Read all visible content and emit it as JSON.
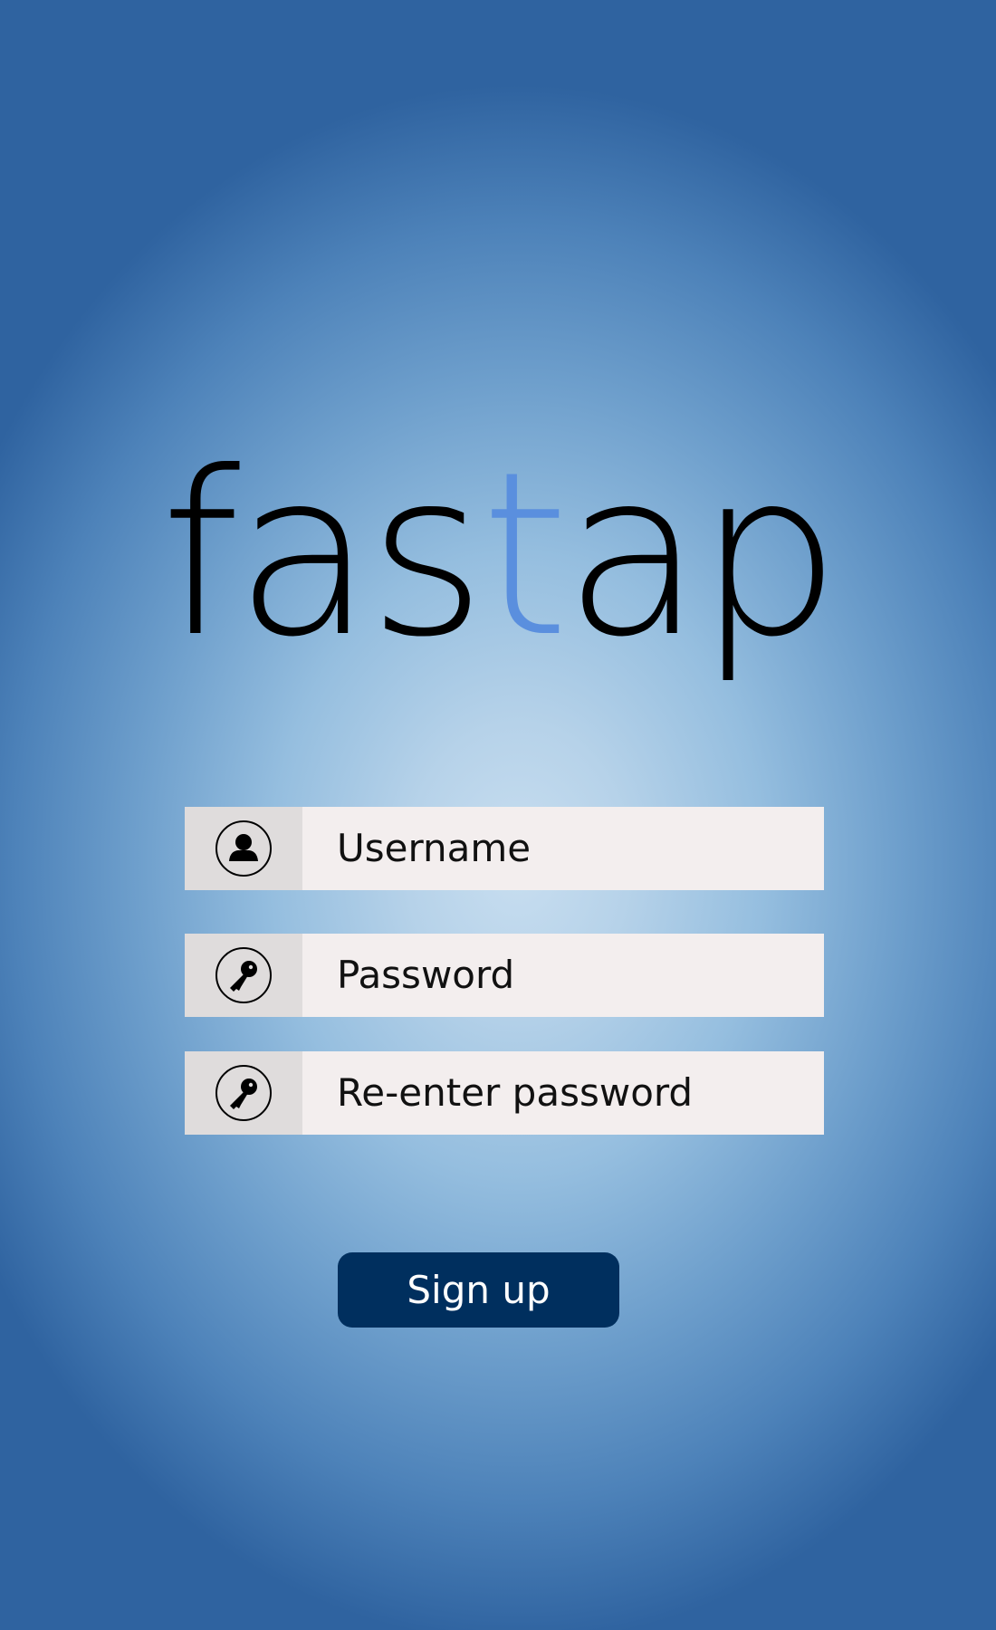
{
  "logo": {
    "part1": "fas",
    "accent": "t",
    "part2": "ap",
    "accent_color": "#5a8fde"
  },
  "form": {
    "username": {
      "placeholder": "Username",
      "icon": "user-icon"
    },
    "password": {
      "placeholder": "Password",
      "icon": "key-icon"
    },
    "confirm_password": {
      "placeholder": "Re-enter password",
      "icon": "key-icon"
    }
  },
  "signup_button": {
    "label": "Sign up",
    "color": "#002f5e"
  }
}
